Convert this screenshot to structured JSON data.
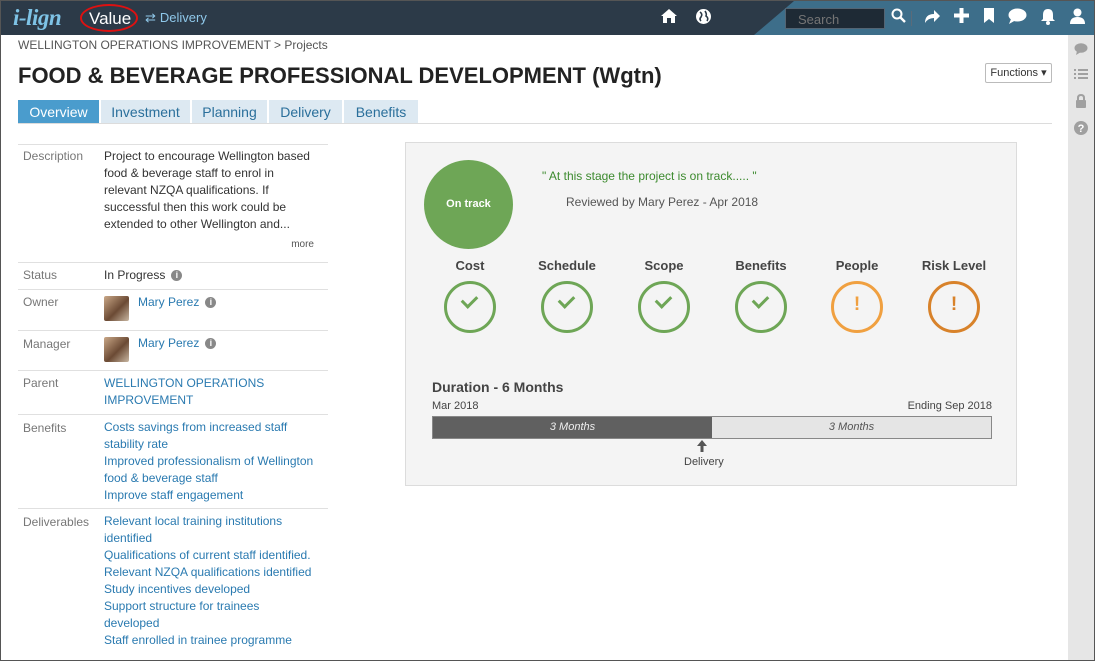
{
  "app": {
    "logo": "i-lign",
    "mode": "Value",
    "switch_label": "Delivery",
    "search_placeholder": "Search"
  },
  "nav_icons": [
    "home-icon",
    "globe-icon",
    "share-icon",
    "plus-icon",
    "bookmark-icon",
    "chat-icon",
    "bell-icon",
    "user-icon"
  ],
  "rail_icons": [
    "comment-icon",
    "list-icon",
    "lock-icon",
    "help-icon"
  ],
  "breadcrumb": {
    "parent": "WELLINGTON OPERATIONS IMPROVEMENT",
    "separator": ">",
    "current": "Projects"
  },
  "page": {
    "title": "FOOD & BEVERAGE PROFESSIONAL DEVELOPMENT (Wgtn)",
    "functions_label": "Functions ▾"
  },
  "tabs": [
    {
      "label": "Overview",
      "active": true
    },
    {
      "label": "Investment",
      "active": false
    },
    {
      "label": "Planning",
      "active": false
    },
    {
      "label": "Delivery",
      "active": false
    },
    {
      "label": "Benefits",
      "active": false
    }
  ],
  "details": {
    "description": {
      "label": "Description",
      "lines": [
        "Project to encourage Wellington based",
        "food & beverage staff to enrol in",
        "relevant NZQA qualifications. If",
        "successful then this work could be",
        "extended to other Wellington and..."
      ],
      "more": "more"
    },
    "status": {
      "label": "Status",
      "value": "In Progress"
    },
    "owner": {
      "label": "Owner",
      "value": "Mary Perez"
    },
    "manager": {
      "label": "Manager",
      "value": "Mary Perez"
    },
    "parent": {
      "label": "Parent",
      "lines": [
        "WELLINGTON OPERATIONS",
        "IMPROVEMENT"
      ]
    },
    "benefits": {
      "label": "Benefits",
      "lines": [
        "Costs savings from increased staff",
        "stability rate",
        "Improved professionalism of Wellington",
        "food & beverage staff",
        "Improve staff engagement"
      ]
    },
    "deliverables": {
      "label": "Deliverables",
      "lines": [
        "Relevant local training institutions",
        "identified",
        "Qualifications of current staff identified.",
        "Relevant NZQA qualifications identified",
        "Study incentives developed",
        "Support structure for trainees",
        "developed",
        "Staff enrolled in trainee programme"
      ]
    }
  },
  "status_panel": {
    "overall": "On track",
    "quote": "\" At this stage the project is on track..... \"",
    "reviewed": "Reviewed by Mary Perez - Apr 2018",
    "metrics": [
      {
        "label": "Cost",
        "state": "ok",
        "color": "#6ea656"
      },
      {
        "label": "Schedule",
        "state": "ok",
        "color": "#6ea656"
      },
      {
        "label": "Scope",
        "state": "ok",
        "color": "#6ea656"
      },
      {
        "label": "Benefits",
        "state": "ok",
        "color": "#6ea656"
      },
      {
        "label": "People",
        "state": "warn",
        "symbol": "!",
        "color": "#f0a040"
      },
      {
        "label": "Risk Level",
        "state": "warn",
        "symbol": "!",
        "color": "#d8822a"
      }
    ],
    "duration": {
      "title": "Duration - 6 Months",
      "start": "Mar 2018",
      "end": "Ending Sep 2018",
      "elapsed_label": "3 Months",
      "remaining_label": "3 Months",
      "elapsed_fraction": 0.5,
      "marker_label": "Delivery"
    }
  },
  "colors": {
    "topbar": "#2c3a48",
    "accent": "#4a9ccd",
    "ok": "#6ea656",
    "link": "#2a7ab0"
  }
}
